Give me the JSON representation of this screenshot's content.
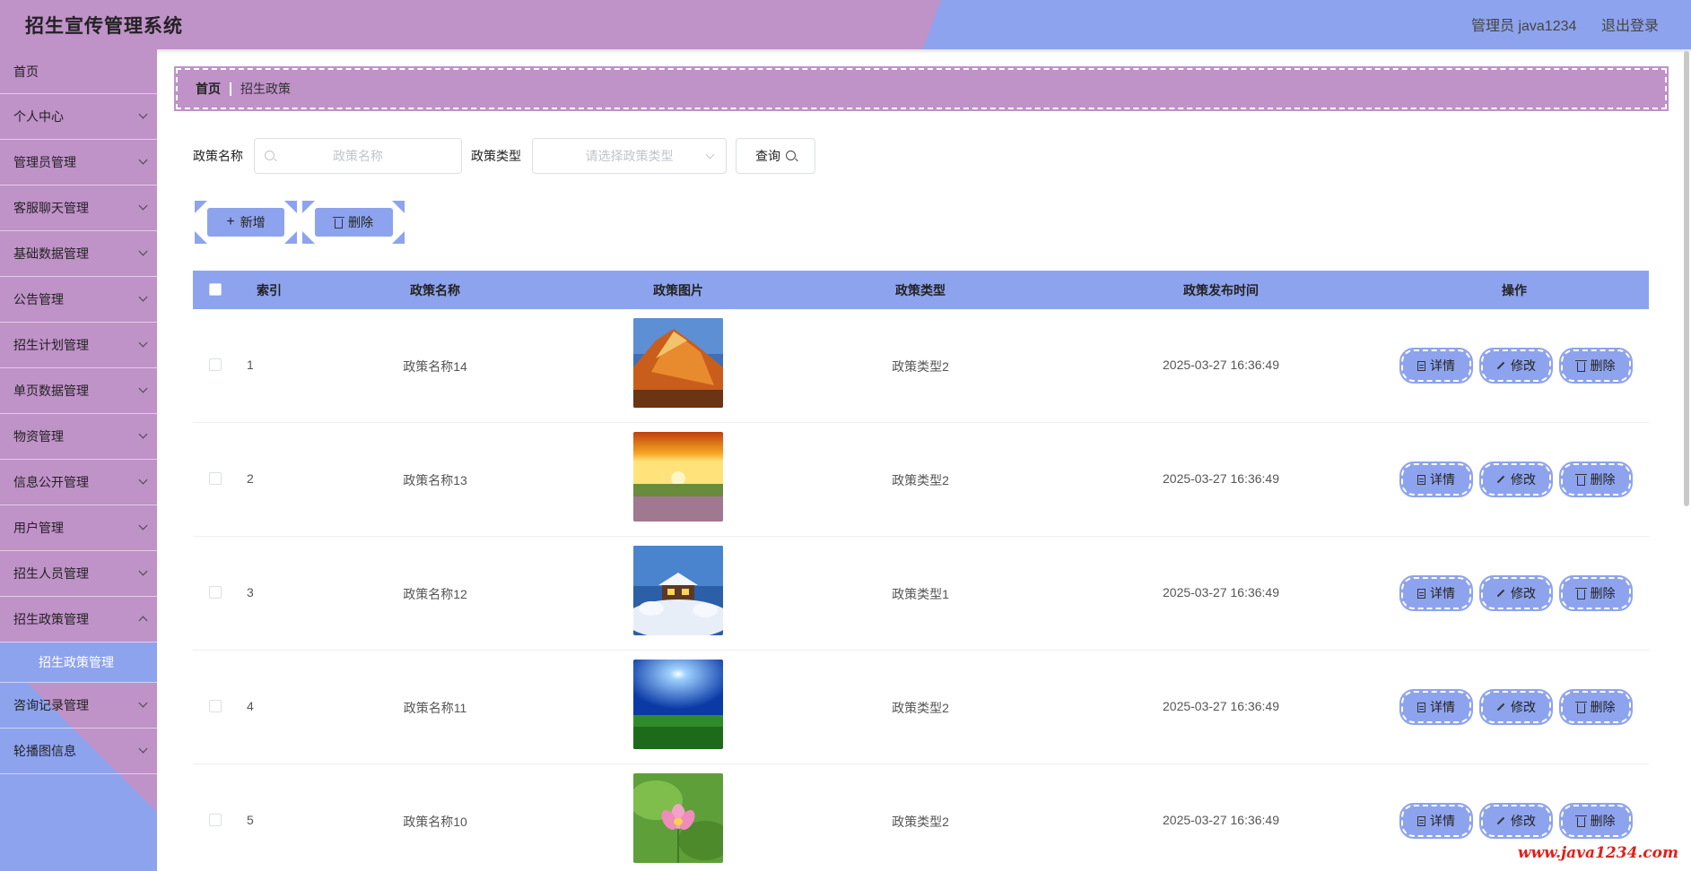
{
  "header": {
    "title": "招生宣传管理系统",
    "user": "管理员 java1234",
    "logout": "退出登录"
  },
  "sidebar": {
    "items": [
      {
        "label": "首页"
      },
      {
        "label": "个人中心"
      },
      {
        "label": "管理员管理"
      },
      {
        "label": "客服聊天管理"
      },
      {
        "label": "基础数据管理"
      },
      {
        "label": "公告管理"
      },
      {
        "label": "招生计划管理"
      },
      {
        "label": "单页数据管理"
      },
      {
        "label": "物资管理"
      },
      {
        "label": "信息公开管理"
      },
      {
        "label": "用户管理"
      },
      {
        "label": "招生人员管理"
      },
      {
        "label": "招生政策管理"
      },
      {
        "label": "咨询记录管理"
      },
      {
        "label": "轮播图信息"
      }
    ],
    "active_sub": "招生政策管理"
  },
  "breadcrumb": {
    "home": "首页",
    "current": "招生政策"
  },
  "search": {
    "name_label": "政策名称",
    "name_placeholder": "政策名称",
    "type_label": "政策类型",
    "type_placeholder": "请选择政策类型",
    "query_button": "查询"
  },
  "actions": {
    "add": "新增",
    "delete": "删除"
  },
  "table": {
    "headers": [
      "索引",
      "政策名称",
      "政策图片",
      "政策类型",
      "政策发布时间",
      "操作"
    ],
    "rows": [
      {
        "index": "1",
        "name": "政策名称14",
        "type": "政策类型2",
        "time": "2025-03-27 16:36:49",
        "image": "mountain-sunset"
      },
      {
        "index": "2",
        "name": "政策名称13",
        "type": "政策类型2",
        "time": "2025-03-27 16:36:49",
        "image": "sunset-field"
      },
      {
        "index": "3",
        "name": "政策名称12",
        "type": "政策类型1",
        "time": "2025-03-27 16:36:49",
        "image": "snow-cabin"
      },
      {
        "index": "4",
        "name": "政策名称11",
        "type": "政策类型2",
        "time": "2025-03-27 16:36:49",
        "image": "blue-sky-meadow"
      },
      {
        "index": "5",
        "name": "政策名称10",
        "type": "政策类型2",
        "time": "2025-03-27 16:36:49",
        "image": "lotus-flower"
      }
    ],
    "row_actions": {
      "detail": "详情",
      "edit": "修改",
      "delete": "删除"
    }
  },
  "watermark": "www.java1234.com",
  "colors": {
    "purple": "#bf92c8",
    "blue": "#8ea3ee"
  }
}
